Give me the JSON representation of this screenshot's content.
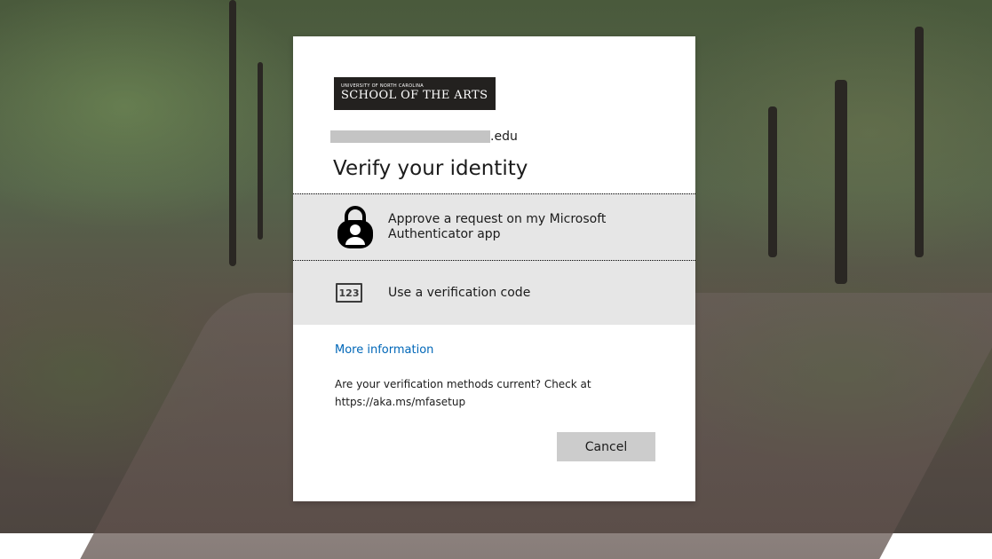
{
  "logo": {
    "subtitle": "UNIVERSITY OF NORTH CAROLINA",
    "name": "SCHOOL OF THE ARTS"
  },
  "account": {
    "suffix": ".edu"
  },
  "title": "Verify your identity",
  "methods": [
    {
      "label": "Approve a request on my Microsoft Authenticator app",
      "icon": "authenticator-lock-icon",
      "selected": true
    },
    {
      "label": "Use a verification code",
      "icon": "verification-code-icon",
      "icon_text": "123",
      "selected": false
    }
  ],
  "more_info_link": "More information",
  "notice": "Are your verification methods current? Check at https://aka.ms/mfasetup",
  "cancel_label": "Cancel",
  "colors": {
    "link": "#0067b8",
    "method_background": "#e6e6e6",
    "button_background": "#cccccc"
  }
}
